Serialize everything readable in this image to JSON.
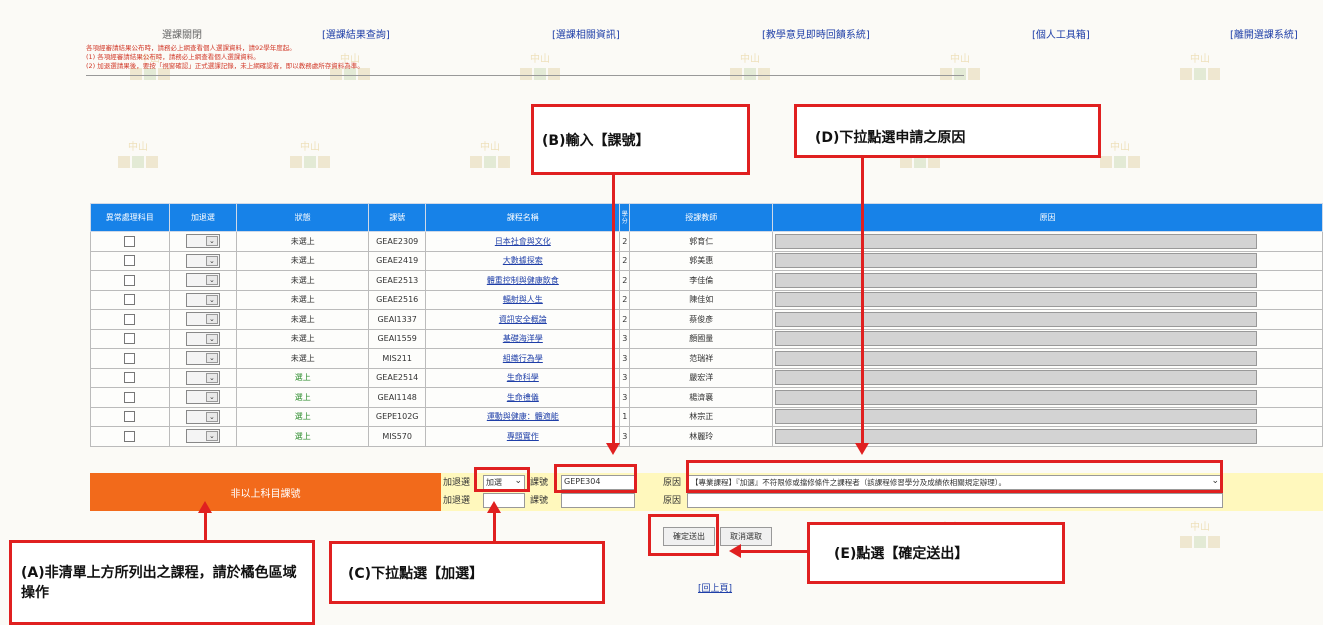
{
  "header": {
    "title": "選課關閉",
    "links": [
      "[選課結果查詢]",
      "[選課相關資訊]",
      "[教學意見即時回饋系統]",
      "[個人工具箱]",
      "[離開選課系統]"
    ],
    "notices": [
      "各項經審請結果公布時，請務必上網查看個人選課資料，請92學年度起。",
      "(1) 各項經審請結果公布時，請務必上網查看個人選課資料。",
      "(2) 加退選請果後，要按「視窗確認」正式選課記錄，未上網確認者，即以教務處所存資料為準。"
    ]
  },
  "table": {
    "headers": [
      "異常處理科目",
      "加退選",
      "狀態",
      "課號",
      "課程名稱",
      "學分",
      "授課教師",
      "原因"
    ],
    "rows": [
      {
        "status": "未選上",
        "code": "GEAE2309",
        "name": "日本社會與文化",
        "credits": "2",
        "teacher": "郭育仁",
        "green": false
      },
      {
        "status": "未選上",
        "code": "GEAE2419",
        "name": "大數據探索",
        "credits": "2",
        "teacher": "郭美惠",
        "green": false
      },
      {
        "status": "未選上",
        "code": "GEAE2513",
        "name": "體重控制與健康飲食",
        "credits": "2",
        "teacher": "李佳倫",
        "green": false
      },
      {
        "status": "未選上",
        "code": "GEAE2516",
        "name": "輻射與人生",
        "credits": "2",
        "teacher": "陳佳如",
        "green": false
      },
      {
        "status": "未選上",
        "code": "GEAI1337",
        "name": "資訊安全概論",
        "credits": "2",
        "teacher": "蔡俊彥",
        "green": false
      },
      {
        "status": "未選上",
        "code": "GEAI1559",
        "name": "基礎海洋學",
        "credits": "3",
        "teacher": "顏國量",
        "green": false
      },
      {
        "status": "未選上",
        "code": "MIS211",
        "name": "組織行為學",
        "credits": "3",
        "teacher": "范瑞祥",
        "green": false
      },
      {
        "status": "選上",
        "code": "GEAE2514",
        "name": "生命科學",
        "credits": "3",
        "teacher": "嚴宏洋",
        "green": true
      },
      {
        "status": "選上",
        "code": "GEAI1148",
        "name": "生命禮儀",
        "credits": "3",
        "teacher": "楊濟襄",
        "green": true
      },
      {
        "status": "選上",
        "code": "GEPE102G",
        "name": "運動與健康：體適能",
        "credits": "1",
        "teacher": "林宗正",
        "green": true
      },
      {
        "status": "選上",
        "code": "MIS570",
        "name": "專題實作",
        "credits": "3",
        "teacher": "林麗玲",
        "green": true
      }
    ]
  },
  "orange_area": {
    "label": "非以上科目課號"
  },
  "form": {
    "row1_prefix": "加退選",
    "row1_select": "加選",
    "course_label": "課號",
    "course_value": "GEPE304",
    "reason_label": "原因",
    "reason_value": "【專業課程】『加選』不符限修或擋修條件之課程者（該課程修習學分及成績依相關規定辦理）。",
    "row2_prefix": "加退選",
    "row2_course_label": "課號",
    "row2_reason_label": "原因"
  },
  "buttons": {
    "submit": "確定送出",
    "cancel": "取消選取"
  },
  "footer": {
    "back": "[回上頁]"
  },
  "callouts": {
    "A": "(A)非清單上方所列出之課程，請於橘色區域操作",
    "B": "(B)輸入【課號】",
    "C": "(C)下拉點選【加選】",
    "D": "(D)下拉點選申請之原因",
    "E": "(E)點選【確定送出】"
  },
  "colors": {
    "header_blue": "#1782e8",
    "orange": "#f26a1b",
    "annotation_red": "#e02020",
    "yellow": "#fff8bd"
  }
}
